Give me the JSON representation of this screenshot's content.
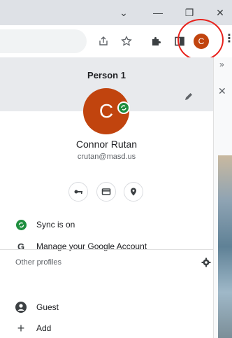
{
  "window_controls": {
    "dropdown_glyph": "⌄",
    "minimize_glyph": "—",
    "restore_glyph": "❐",
    "close_glyph": "✕"
  },
  "toolbar": {
    "avatar_initial": "C",
    "icons": [
      "share-icon",
      "bookmark-star-icon",
      "extensions-puzzle-icon",
      "side-panel-icon",
      "profile-avatar",
      "more-vert-icon"
    ]
  },
  "side_strip": {
    "chevron": "»",
    "close": "✕"
  },
  "profile": {
    "header_name": "Person 1",
    "avatar_initial": "C",
    "full_name": "Connor Rutan",
    "email": "crutan@masd.us",
    "accent_color": "#c1440e",
    "sync_color": "#1e8e3e"
  },
  "menu": {
    "sync_label": "Sync is on",
    "manage_label": "Manage your Google Account"
  },
  "other_profiles": {
    "section_label": "Other profiles",
    "guest_label": "Guest",
    "add_label": "Add"
  }
}
